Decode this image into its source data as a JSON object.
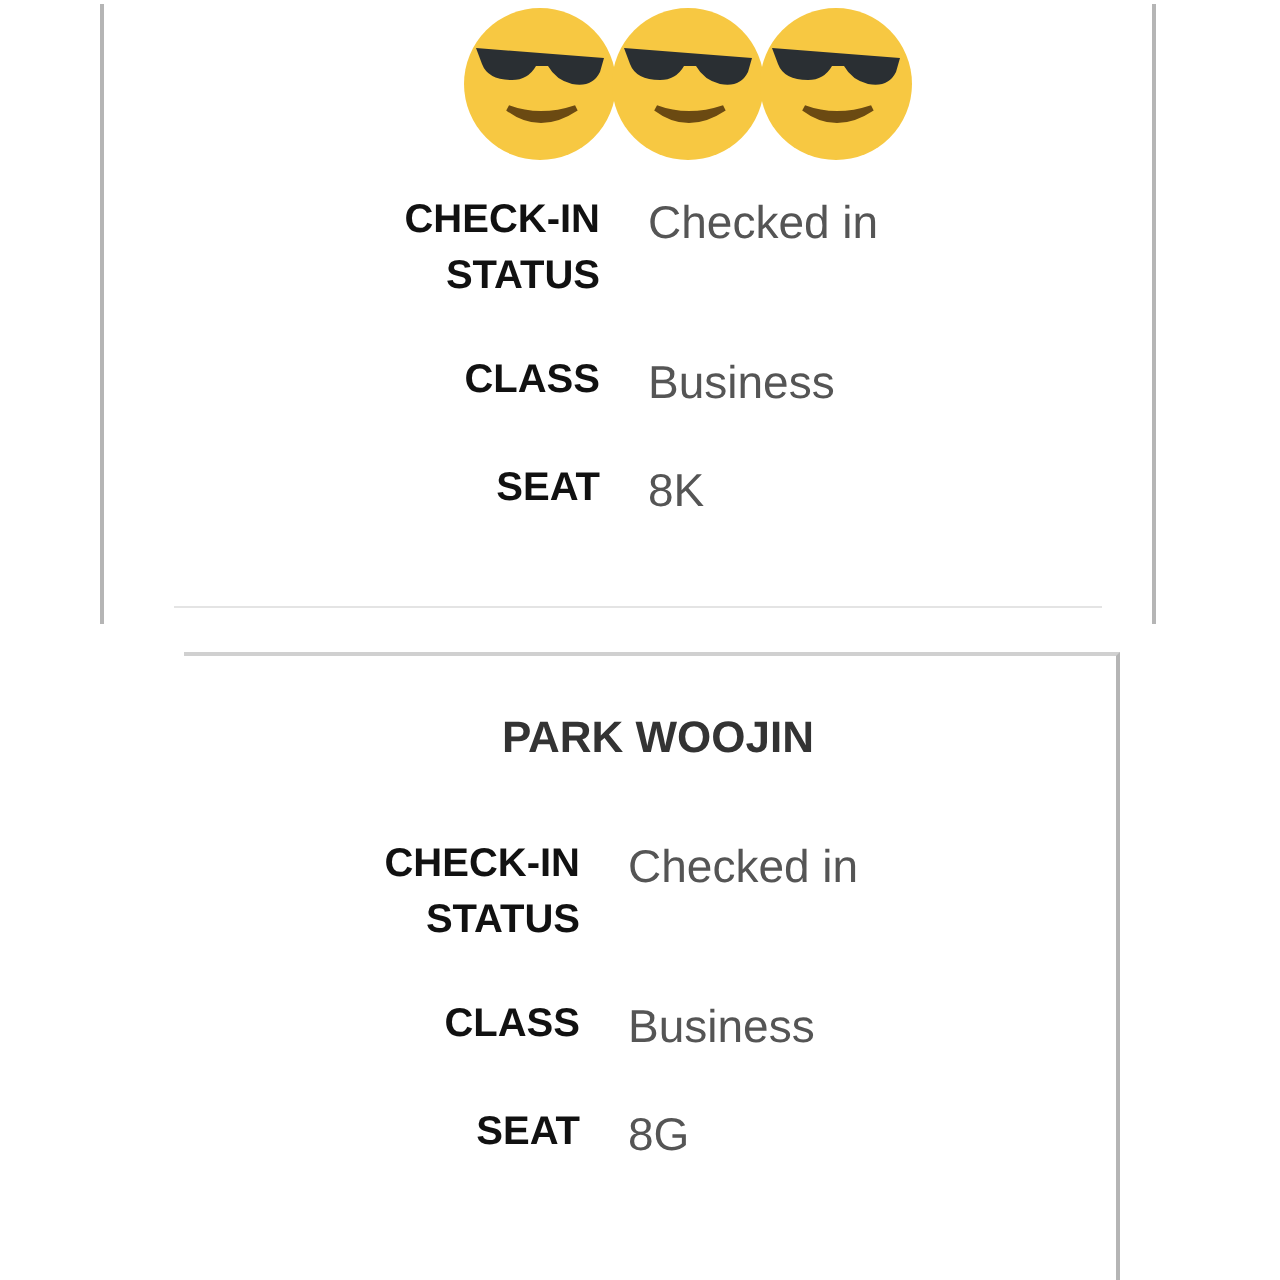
{
  "panels": [
    {
      "header": {
        "kind": "emoji"
      },
      "fields": [
        {
          "label": [
            "CHECK-IN",
            "STATUS"
          ],
          "value": "Checked in"
        },
        {
          "label": [
            "CLASS"
          ],
          "value": "Business"
        },
        {
          "label": [
            "SEAT"
          ],
          "value": "8K"
        }
      ]
    },
    {
      "header": {
        "kind": "name",
        "text": "PARK WOOJIN"
      },
      "fields": [
        {
          "label": [
            "CHECK-IN",
            "STATUS"
          ],
          "value": "Checked in"
        },
        {
          "label": [
            "CLASS"
          ],
          "value": "Business"
        },
        {
          "label": [
            "SEAT"
          ],
          "value": "8G"
        }
      ]
    }
  ]
}
